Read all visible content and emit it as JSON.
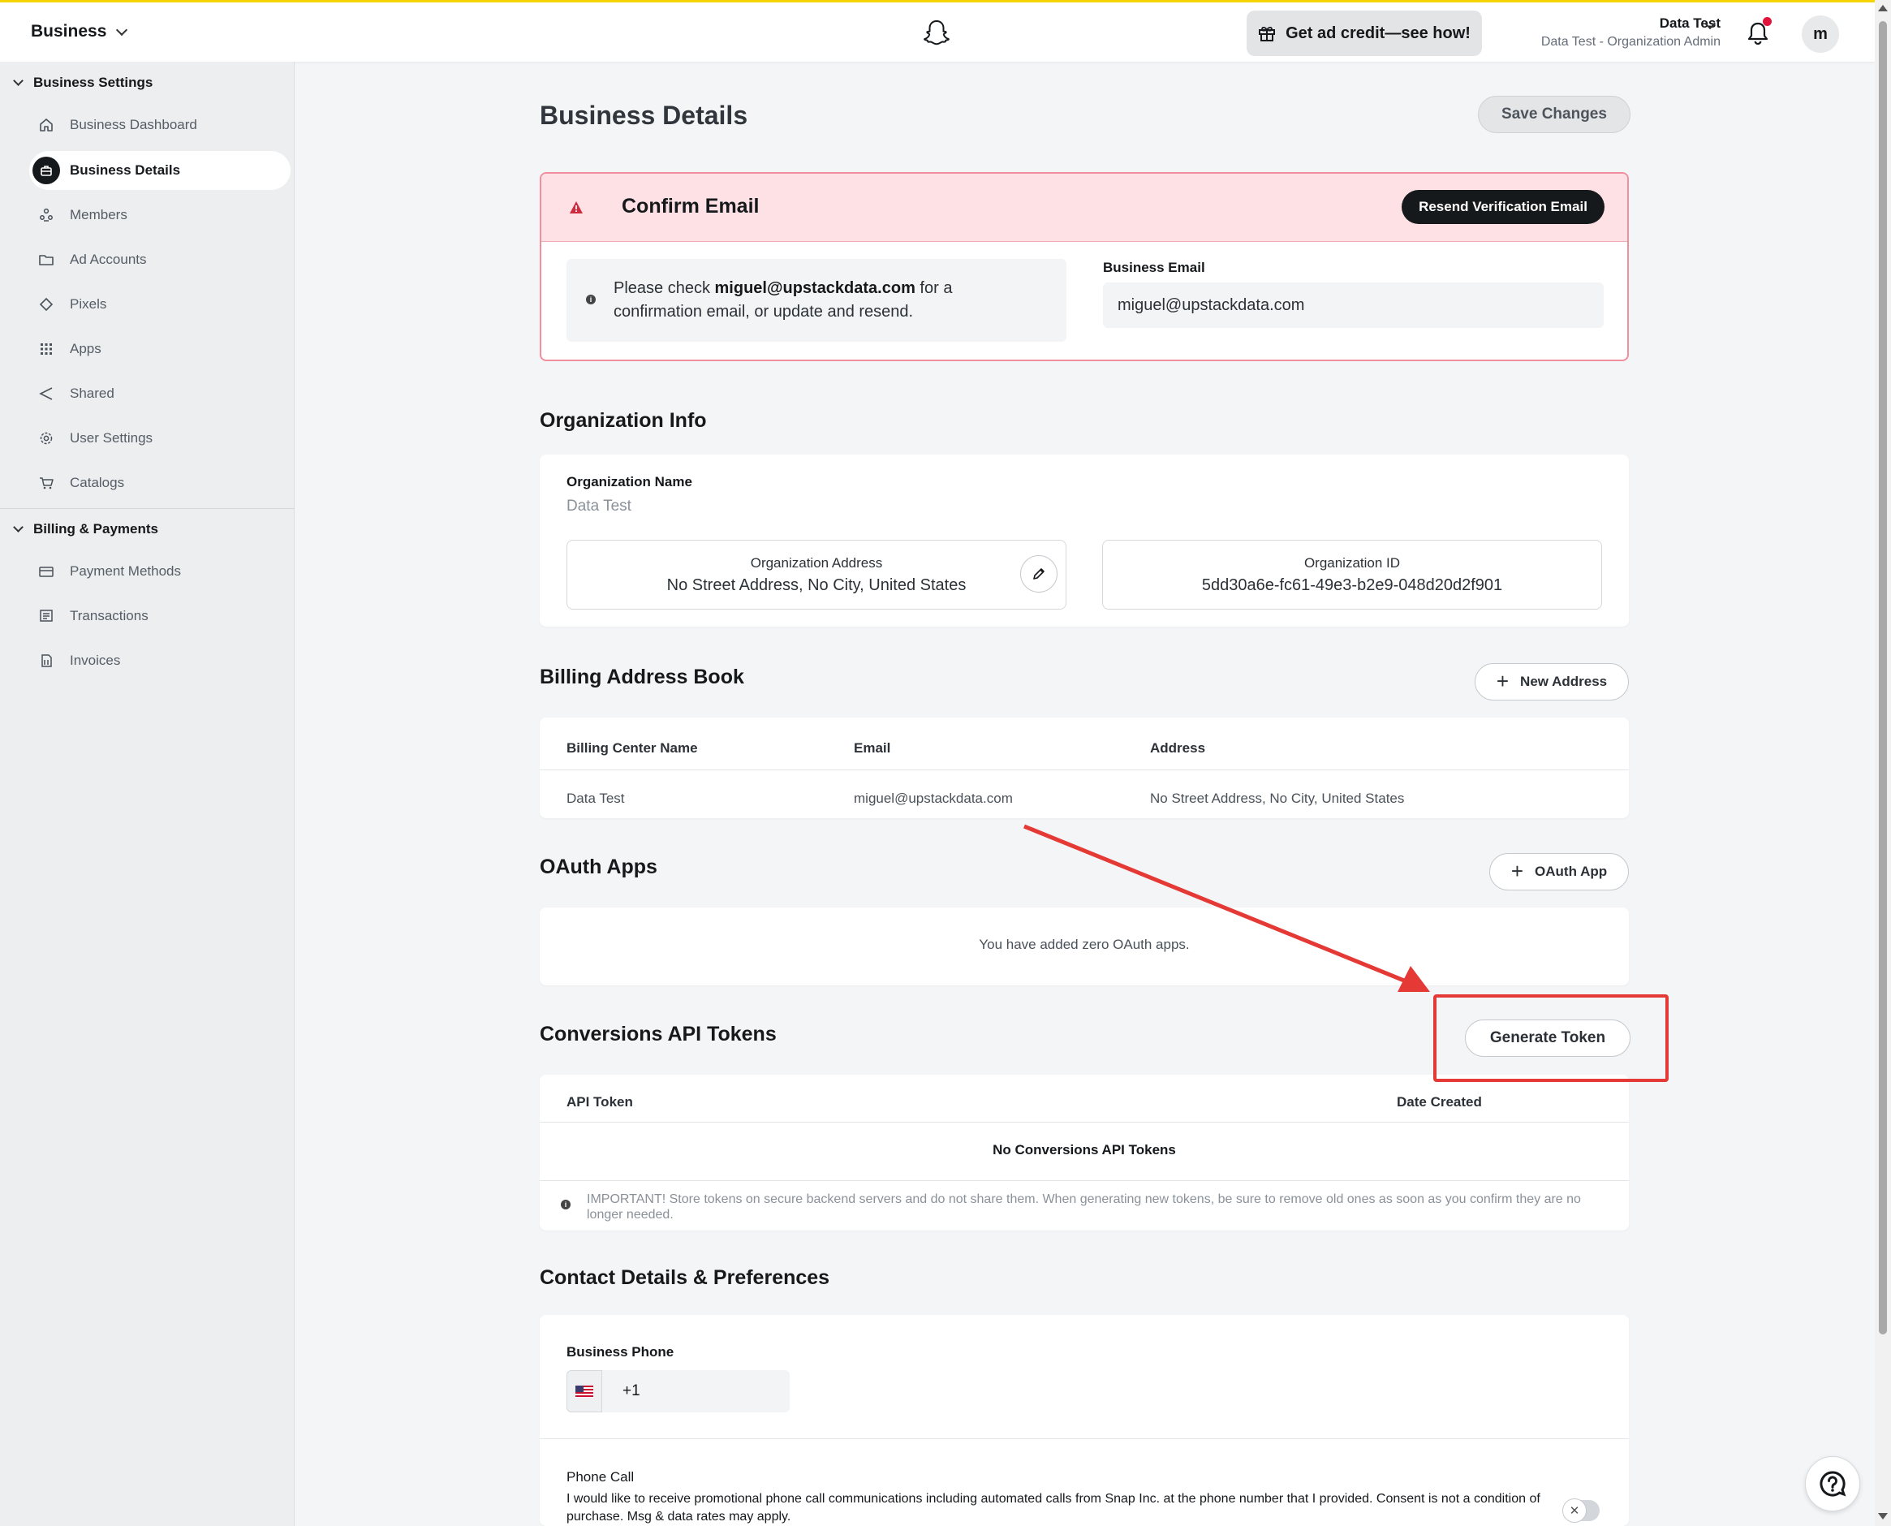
{
  "topbar": {
    "brand": "Business",
    "promo_label": "Get ad credit—see how!",
    "account_name": "Data Test",
    "account_role": "Data Test - Organization Admin",
    "avatar_letter": "m",
    "notification_dot_color": "#e1143c"
  },
  "sidebar": {
    "section1": "Business Settings",
    "items1": [
      {
        "label": "Business Dashboard",
        "icon": "home-icon"
      },
      {
        "label": "Business Details",
        "icon": "briefcase-icon",
        "active": true
      },
      {
        "label": "Members",
        "icon": "members-icon"
      },
      {
        "label": "Ad Accounts",
        "icon": "folder-icon"
      },
      {
        "label": "Pixels",
        "icon": "diamond-icon"
      },
      {
        "label": "Apps",
        "icon": "grid-icon"
      },
      {
        "label": "Shared",
        "icon": "share-icon"
      },
      {
        "label": "User Settings",
        "icon": "gear-icon"
      },
      {
        "label": "Catalogs",
        "icon": "cart-icon"
      }
    ],
    "section2": "Billing & Payments",
    "items2": [
      {
        "label": "Payment Methods",
        "icon": "card-icon"
      },
      {
        "label": "Transactions",
        "icon": "receipt-icon"
      },
      {
        "label": "Invoices",
        "icon": "invoice-icon"
      }
    ]
  },
  "page": {
    "title": "Business Details",
    "save_label": "Save Changes"
  },
  "confirm_email": {
    "title": "Confirm Email",
    "resend_label": "Resend Verification Email",
    "note_prefix": "Please check ",
    "note_email": "miguel@upstackdata.com",
    "note_suffix": " for a confirmation email, or update and resend.",
    "business_email_label": "Business Email",
    "business_email_value": "miguel@upstackdata.com",
    "accent_color": "#f0909f"
  },
  "org_info": {
    "heading": "Organization Info",
    "name_label": "Organization Name",
    "name_value": "Data Test",
    "address_label": "Organization Address",
    "address_value": "No Street Address, No City, United States",
    "id_label": "Organization ID",
    "id_value": "5dd30a6e-fc61-49e3-b2e9-048d20d2f901"
  },
  "billing_book": {
    "heading": "Billing Address Book",
    "new_label": "New Address",
    "columns": [
      "Billing Center Name",
      "Email",
      "Address"
    ],
    "rows": [
      [
        "Data Test",
        "miguel@upstackdata.com",
        "No Street Address, No City, United States"
      ]
    ]
  },
  "oauth": {
    "heading": "OAuth Apps",
    "add_label": "OAuth App",
    "empty": "You have added zero OAuth apps."
  },
  "capi": {
    "heading": "Conversions API Tokens",
    "generate_label": "Generate Token",
    "col_token": "API Token",
    "col_date": "Date Created",
    "empty": "No Conversions API Tokens",
    "important": "IMPORTANT! Store tokens on secure backend servers and do not share them. When generating new tokens, be sure to remove old ones as soon as you confirm they are no longer needed."
  },
  "contact": {
    "heading": "Contact Details & Preferences",
    "phone_label": "Business Phone",
    "phone_code": "+1",
    "phone_call_label": "Phone Call",
    "phone_call_text": "I would like to receive promotional phone call communications including automated calls from Snap Inc. at the phone number that I provided. Consent is not a condition of purchase. Msg & data rates may apply."
  },
  "annotation_color": "#e53935"
}
